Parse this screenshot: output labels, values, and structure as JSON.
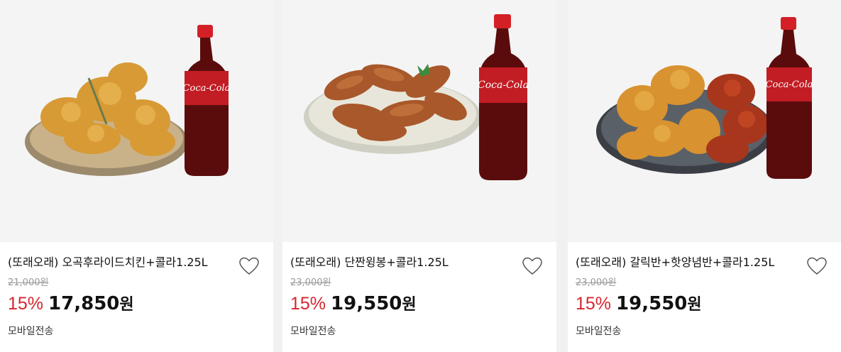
{
  "products": [
    {
      "title": "(또래오래) 오곡후라이드치킨+콜라1.25L",
      "original_price": "21,000원",
      "discount": "15%",
      "price": "17,850",
      "price_unit": "원",
      "shipping": "모바일전송",
      "image": "fried-chicken-cola"
    },
    {
      "title": "(또래오래) 단짠윙봉+콜라1.25L",
      "original_price": "23,000원",
      "discount": "15%",
      "price": "19,550",
      "price_unit": "원",
      "shipping": "모바일전송",
      "image": "wings-cola"
    },
    {
      "title": "(또래오래) 갈릭반+핫양념반+콜라1.25L",
      "original_price": "23,000원",
      "discount": "15%",
      "price": "19,550",
      "price_unit": "원",
      "shipping": "모바일전송",
      "image": "half-half-chicken-cola"
    }
  ],
  "colors": {
    "discount": "#d7262f",
    "background": "#f1f1f1",
    "card": "#ffffff"
  },
  "icons": {
    "wishlist": "heart-outline-icon"
  }
}
